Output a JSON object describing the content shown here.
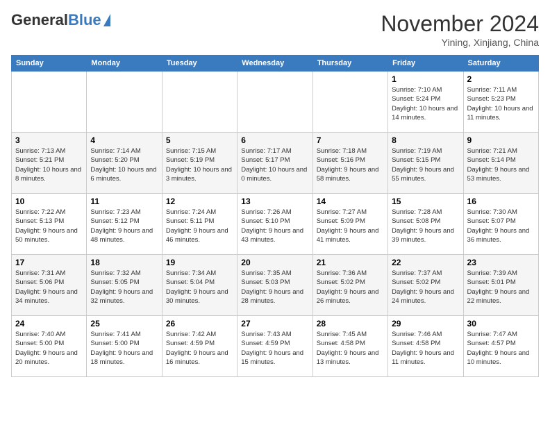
{
  "logo": {
    "general": "General",
    "blue": "Blue"
  },
  "header": {
    "month": "November 2024",
    "location": "Yining, Xinjiang, China"
  },
  "weekdays": [
    "Sunday",
    "Monday",
    "Tuesday",
    "Wednesday",
    "Thursday",
    "Friday",
    "Saturday"
  ],
  "weeks": [
    [
      {
        "day": "",
        "info": ""
      },
      {
        "day": "",
        "info": ""
      },
      {
        "day": "",
        "info": ""
      },
      {
        "day": "",
        "info": ""
      },
      {
        "day": "",
        "info": ""
      },
      {
        "day": "1",
        "info": "Sunrise: 7:10 AM\nSunset: 5:24 PM\nDaylight: 10 hours and 14 minutes."
      },
      {
        "day": "2",
        "info": "Sunrise: 7:11 AM\nSunset: 5:23 PM\nDaylight: 10 hours and 11 minutes."
      }
    ],
    [
      {
        "day": "3",
        "info": "Sunrise: 7:13 AM\nSunset: 5:21 PM\nDaylight: 10 hours and 8 minutes."
      },
      {
        "day": "4",
        "info": "Sunrise: 7:14 AM\nSunset: 5:20 PM\nDaylight: 10 hours and 6 minutes."
      },
      {
        "day": "5",
        "info": "Sunrise: 7:15 AM\nSunset: 5:19 PM\nDaylight: 10 hours and 3 minutes."
      },
      {
        "day": "6",
        "info": "Sunrise: 7:17 AM\nSunset: 5:17 PM\nDaylight: 10 hours and 0 minutes."
      },
      {
        "day": "7",
        "info": "Sunrise: 7:18 AM\nSunset: 5:16 PM\nDaylight: 9 hours and 58 minutes."
      },
      {
        "day": "8",
        "info": "Sunrise: 7:19 AM\nSunset: 5:15 PM\nDaylight: 9 hours and 55 minutes."
      },
      {
        "day": "9",
        "info": "Sunrise: 7:21 AM\nSunset: 5:14 PM\nDaylight: 9 hours and 53 minutes."
      }
    ],
    [
      {
        "day": "10",
        "info": "Sunrise: 7:22 AM\nSunset: 5:13 PM\nDaylight: 9 hours and 50 minutes."
      },
      {
        "day": "11",
        "info": "Sunrise: 7:23 AM\nSunset: 5:12 PM\nDaylight: 9 hours and 48 minutes."
      },
      {
        "day": "12",
        "info": "Sunrise: 7:24 AM\nSunset: 5:11 PM\nDaylight: 9 hours and 46 minutes."
      },
      {
        "day": "13",
        "info": "Sunrise: 7:26 AM\nSunset: 5:10 PM\nDaylight: 9 hours and 43 minutes."
      },
      {
        "day": "14",
        "info": "Sunrise: 7:27 AM\nSunset: 5:09 PM\nDaylight: 9 hours and 41 minutes."
      },
      {
        "day": "15",
        "info": "Sunrise: 7:28 AM\nSunset: 5:08 PM\nDaylight: 9 hours and 39 minutes."
      },
      {
        "day": "16",
        "info": "Sunrise: 7:30 AM\nSunset: 5:07 PM\nDaylight: 9 hours and 36 minutes."
      }
    ],
    [
      {
        "day": "17",
        "info": "Sunrise: 7:31 AM\nSunset: 5:06 PM\nDaylight: 9 hours and 34 minutes."
      },
      {
        "day": "18",
        "info": "Sunrise: 7:32 AM\nSunset: 5:05 PM\nDaylight: 9 hours and 32 minutes."
      },
      {
        "day": "19",
        "info": "Sunrise: 7:34 AM\nSunset: 5:04 PM\nDaylight: 9 hours and 30 minutes."
      },
      {
        "day": "20",
        "info": "Sunrise: 7:35 AM\nSunset: 5:03 PM\nDaylight: 9 hours and 28 minutes."
      },
      {
        "day": "21",
        "info": "Sunrise: 7:36 AM\nSunset: 5:02 PM\nDaylight: 9 hours and 26 minutes."
      },
      {
        "day": "22",
        "info": "Sunrise: 7:37 AM\nSunset: 5:02 PM\nDaylight: 9 hours and 24 minutes."
      },
      {
        "day": "23",
        "info": "Sunrise: 7:39 AM\nSunset: 5:01 PM\nDaylight: 9 hours and 22 minutes."
      }
    ],
    [
      {
        "day": "24",
        "info": "Sunrise: 7:40 AM\nSunset: 5:00 PM\nDaylight: 9 hours and 20 minutes."
      },
      {
        "day": "25",
        "info": "Sunrise: 7:41 AM\nSunset: 5:00 PM\nDaylight: 9 hours and 18 minutes."
      },
      {
        "day": "26",
        "info": "Sunrise: 7:42 AM\nSunset: 4:59 PM\nDaylight: 9 hours and 16 minutes."
      },
      {
        "day": "27",
        "info": "Sunrise: 7:43 AM\nSunset: 4:59 PM\nDaylight: 9 hours and 15 minutes."
      },
      {
        "day": "28",
        "info": "Sunrise: 7:45 AM\nSunset: 4:58 PM\nDaylight: 9 hours and 13 minutes."
      },
      {
        "day": "29",
        "info": "Sunrise: 7:46 AM\nSunset: 4:58 PM\nDaylight: 9 hours and 11 minutes."
      },
      {
        "day": "30",
        "info": "Sunrise: 7:47 AM\nSunset: 4:57 PM\nDaylight: 9 hours and 10 minutes."
      }
    ]
  ]
}
